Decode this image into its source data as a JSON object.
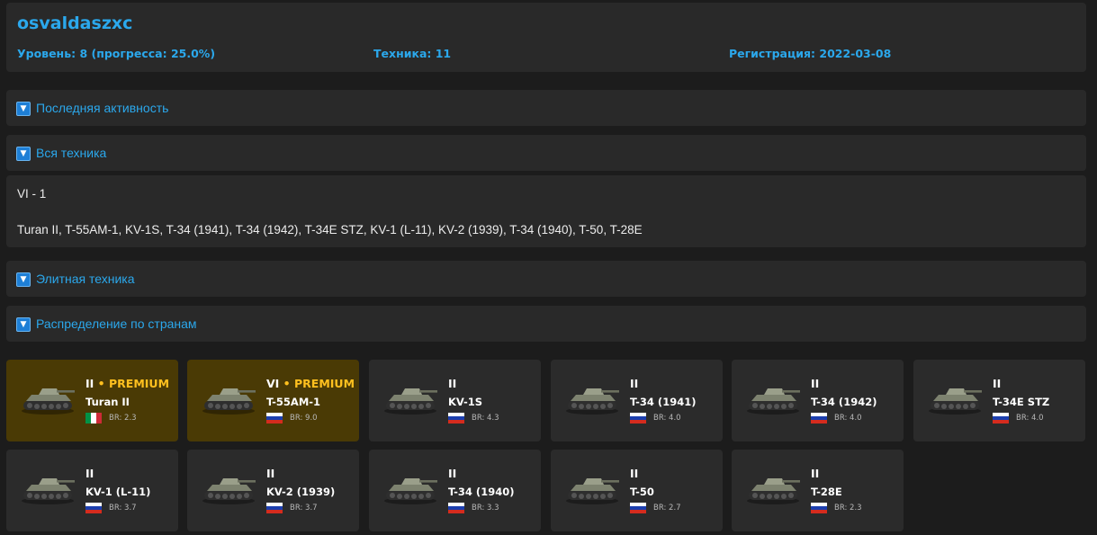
{
  "profile": {
    "username": "osvaldaszxc",
    "level": "Уровень: 8 (прогресса: 25.0%)",
    "vehicles": "Техника: 11",
    "registered": "Регистрация: 2022-03-08"
  },
  "sections": {
    "recent": "Последняя активность",
    "all": "Вся техника",
    "elite": "Элитная техника",
    "countries": "Распределение по странам",
    "toggle_icon": "▼"
  },
  "all_vehicles": {
    "tier_summary": "VI - 1",
    "list": "Turan II, T-55AM-1, KV-1S, T-34 (1941), T-34 (1942), T-34E STZ, KV-1 (L-11), KV-2 (1939), T-34 (1940), T-50, T-28E"
  },
  "colors": {
    "accent": "#2ba8ec",
    "premium_bg": "#4a3a05",
    "premium_text": "#ffc01f",
    "card_bg": "#2b2b2b"
  },
  "vehicle_cards": [
    {
      "tier": "II",
      "premium": true,
      "premium_label": "PREMIUM",
      "name": "Turan II",
      "nation": "italy",
      "br": "BR: 2.3",
      "icon": "tank-icon"
    },
    {
      "tier": "VI",
      "premium": true,
      "premium_label": "PREMIUM",
      "name": "T-55AM-1",
      "nation": "russia",
      "br": "BR: 9.0",
      "icon": "tank-icon"
    },
    {
      "tier": "II",
      "premium": false,
      "name": "KV-1S",
      "nation": "russia",
      "br": "BR: 4.3",
      "icon": "tank-icon"
    },
    {
      "tier": "II",
      "premium": false,
      "name": "T-34 (1941)",
      "nation": "russia",
      "br": "BR: 4.0",
      "icon": "tank-icon"
    },
    {
      "tier": "II",
      "premium": false,
      "name": "T-34 (1942)",
      "nation": "russia",
      "br": "BR: 4.0",
      "icon": "tank-icon"
    },
    {
      "tier": "II",
      "premium": false,
      "name": "T-34E STZ",
      "nation": "russia",
      "br": "BR: 4.0",
      "icon": "tank-icon"
    },
    {
      "tier": "II",
      "premium": false,
      "name": "KV-1 (L-11)",
      "nation": "russia",
      "br": "BR: 3.7",
      "icon": "tank-icon"
    },
    {
      "tier": "II",
      "premium": false,
      "name": "KV-2 (1939)",
      "nation": "russia",
      "br": "BR: 3.7",
      "icon": "tank-icon"
    },
    {
      "tier": "II",
      "premium": false,
      "name": "T-34 (1940)",
      "nation": "russia",
      "br": "BR: 3.3",
      "icon": "tank-icon"
    },
    {
      "tier": "II",
      "premium": false,
      "name": "T-50",
      "nation": "russia",
      "br": "BR: 2.7",
      "icon": "tank-icon"
    },
    {
      "tier": "II",
      "premium": false,
      "name": "T-28E",
      "nation": "russia",
      "br": "BR: 2.3",
      "icon": "tank-icon"
    }
  ]
}
